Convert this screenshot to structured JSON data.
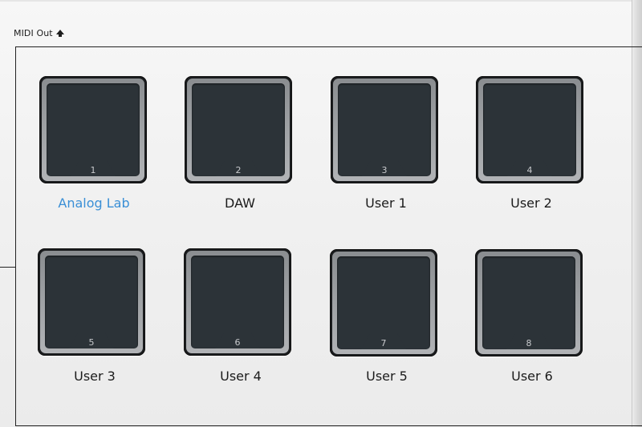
{
  "midi_out": {
    "label": "MIDI Out",
    "icon": "arrow-up-icon"
  },
  "colors": {
    "active_label": "#3a8fd6",
    "label": "#1b1b1b",
    "pad_face": "#2c3338",
    "pad_ring": "#9fa2a5",
    "surface": "#f2f2f2"
  },
  "pads": [
    {
      "number": "1",
      "label": "Analog Lab",
      "active": true
    },
    {
      "number": "2",
      "label": "DAW",
      "active": false
    },
    {
      "number": "3",
      "label": "User 1",
      "active": false
    },
    {
      "number": "4",
      "label": "User 2",
      "active": false
    },
    {
      "number": "5",
      "label": "User 3",
      "active": false
    },
    {
      "number": "6",
      "label": "User 4",
      "active": false
    },
    {
      "number": "7",
      "label": "User 5",
      "active": false
    },
    {
      "number": "8",
      "label": "User 6",
      "active": false
    }
  ]
}
